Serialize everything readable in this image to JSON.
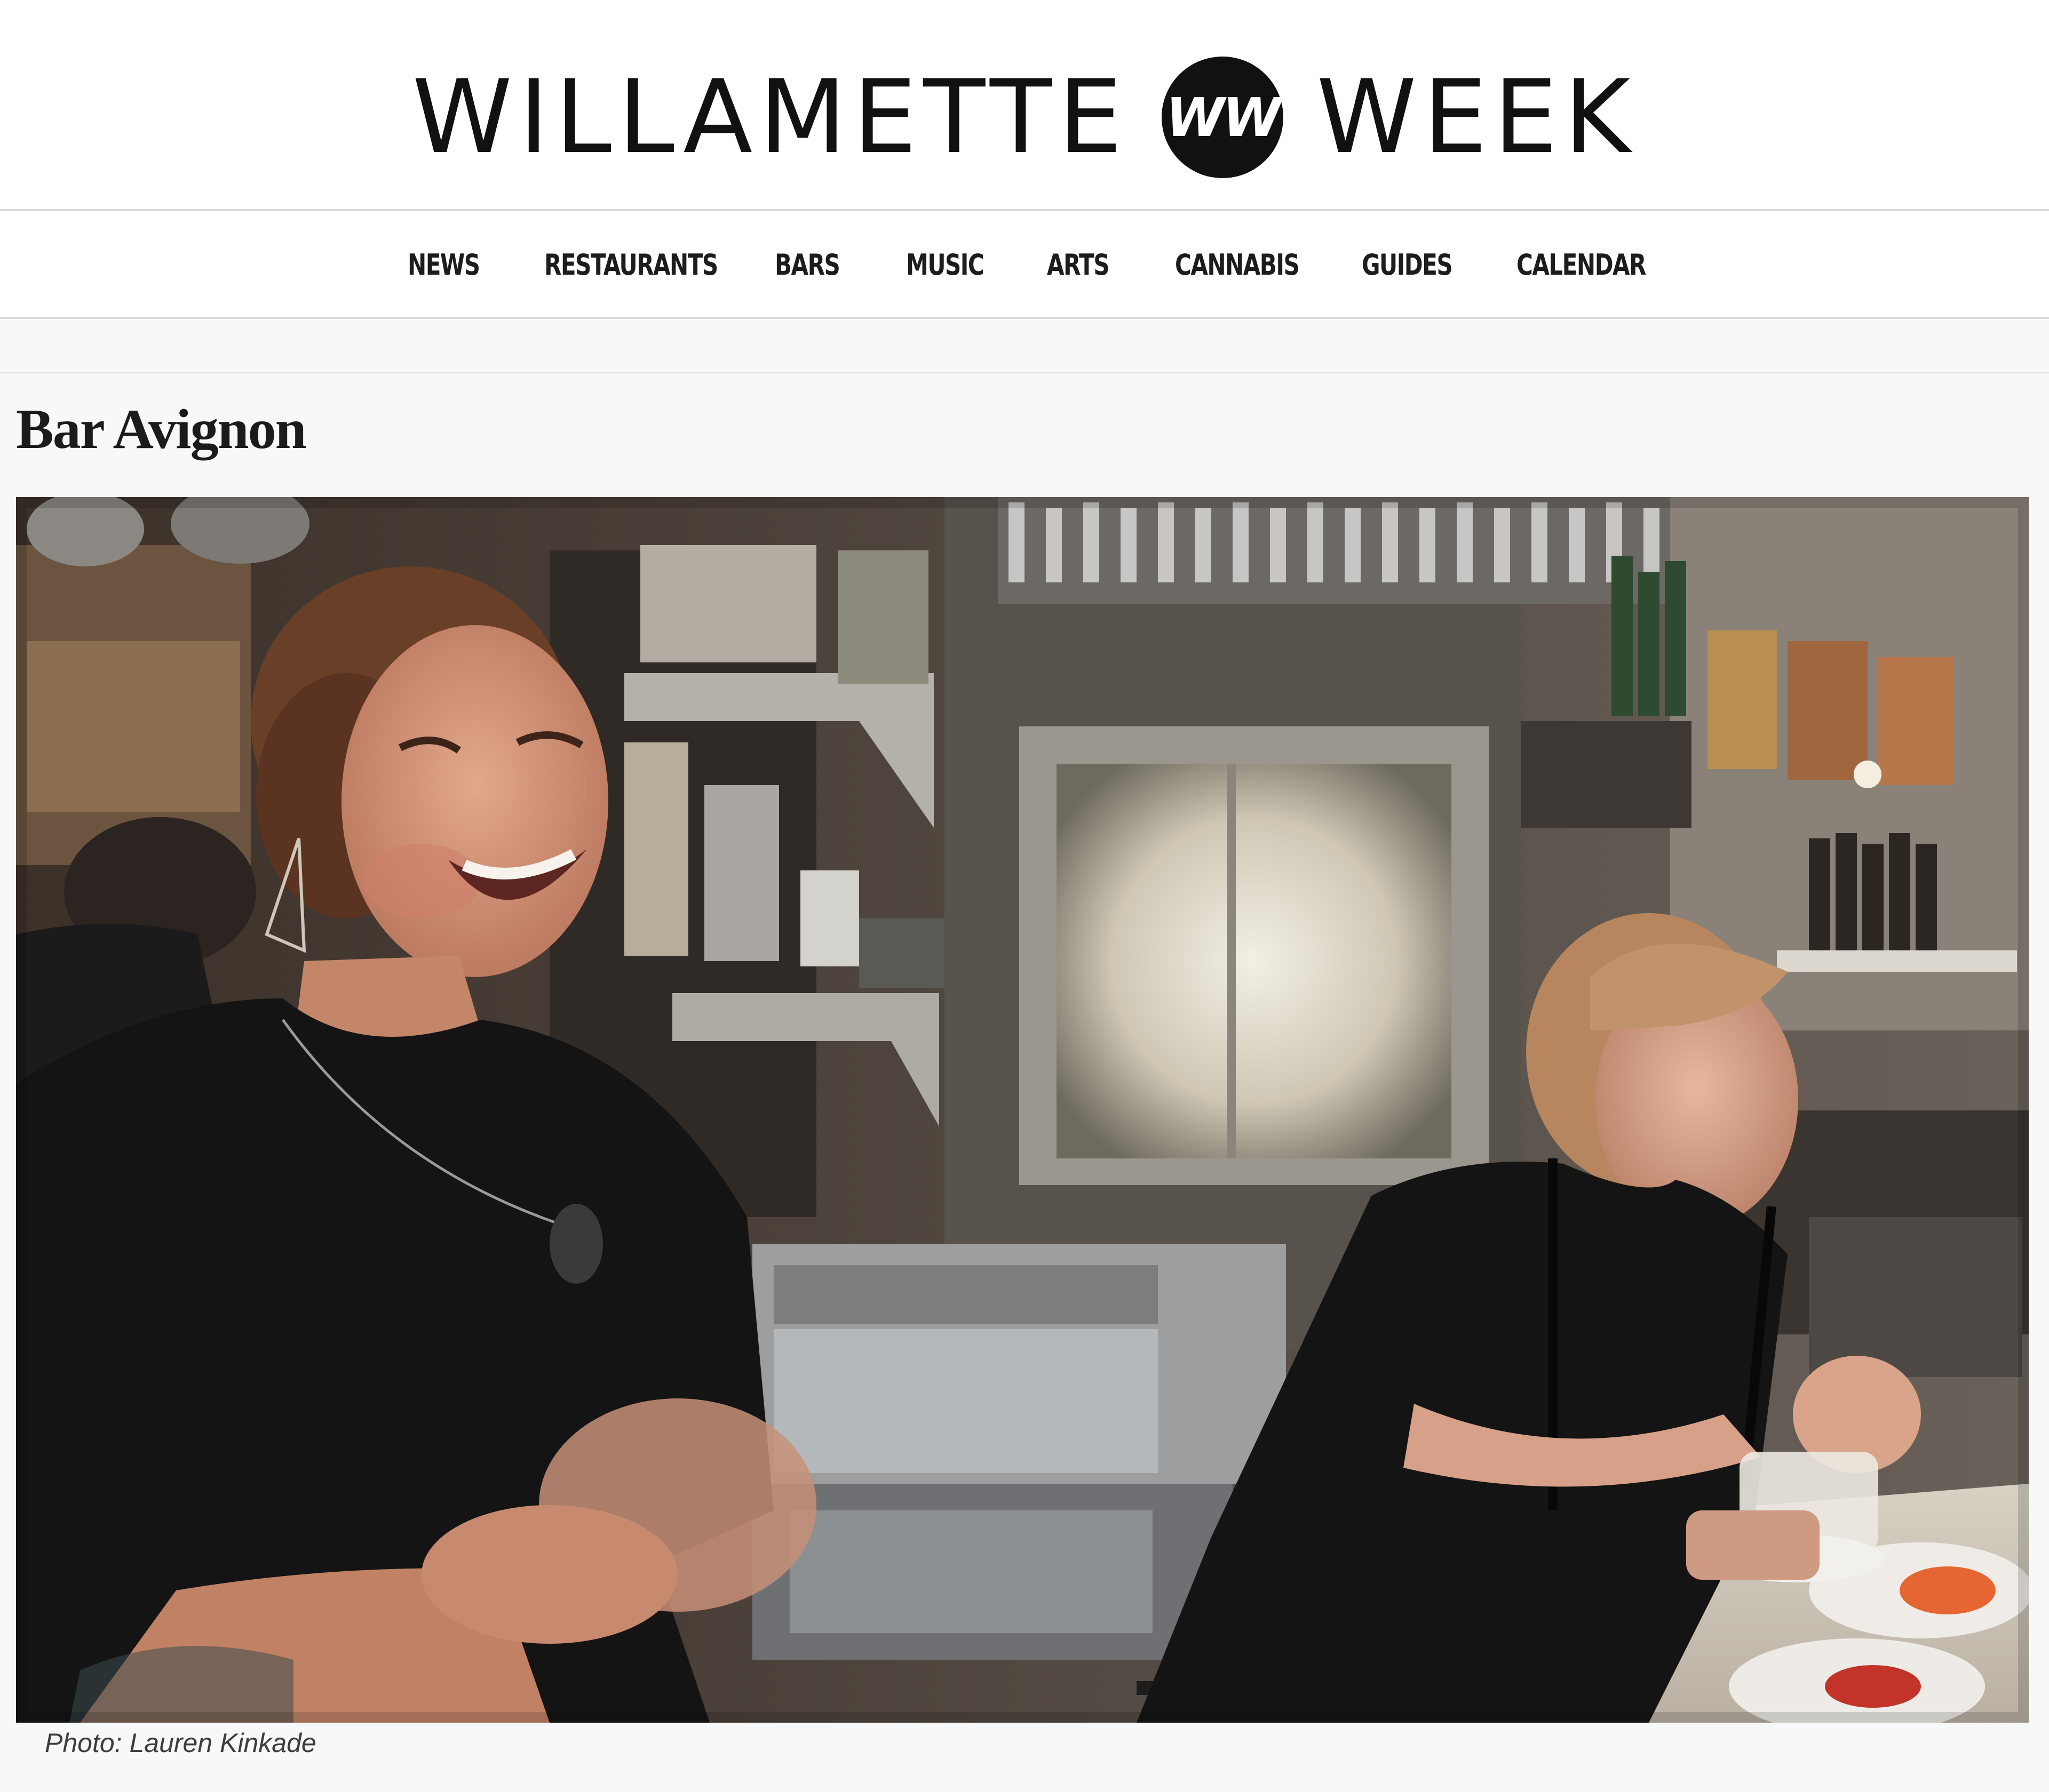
{
  "header": {
    "brand_left": "WILLAMETTE",
    "brand_logo": "WW",
    "brand_right": "WEEK"
  },
  "nav": {
    "items": [
      {
        "label": "NEWS"
      },
      {
        "label": "RESTAURANTS"
      },
      {
        "label": "BARS"
      },
      {
        "label": "MUSIC"
      },
      {
        "label": "ARTS"
      },
      {
        "label": "CANNABIS"
      },
      {
        "label": "GUIDES"
      },
      {
        "label": "CALENDAR"
      }
    ]
  },
  "article": {
    "title": "Bar Avignon",
    "photo_caption": "Photo: Lauren Kinkade"
  },
  "colors": {
    "page_background": "#f7f8f9",
    "header_background": "#ffffff",
    "brand_text": "#111111",
    "divider": "#d7d9dc"
  }
}
